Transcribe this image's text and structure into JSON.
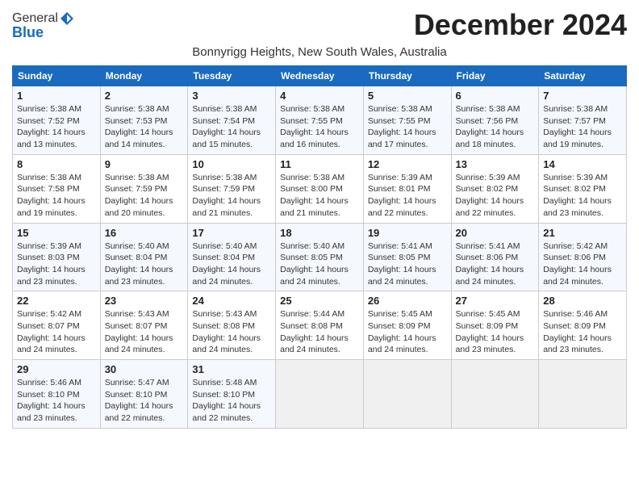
{
  "logo": {
    "general": "General",
    "blue": "Blue"
  },
  "title": "December 2024",
  "subtitle": "Bonnyrigg Heights, New South Wales, Australia",
  "days_header": [
    "Sunday",
    "Monday",
    "Tuesday",
    "Wednesday",
    "Thursday",
    "Friday",
    "Saturday"
  ],
  "weeks": [
    [
      {
        "day": "1",
        "info": "Sunrise: 5:38 AM\nSunset: 7:52 PM\nDaylight: 14 hours\nand 13 minutes."
      },
      {
        "day": "2",
        "info": "Sunrise: 5:38 AM\nSunset: 7:53 PM\nDaylight: 14 hours\nand 14 minutes."
      },
      {
        "day": "3",
        "info": "Sunrise: 5:38 AM\nSunset: 7:54 PM\nDaylight: 14 hours\nand 15 minutes."
      },
      {
        "day": "4",
        "info": "Sunrise: 5:38 AM\nSunset: 7:55 PM\nDaylight: 14 hours\nand 16 minutes."
      },
      {
        "day": "5",
        "info": "Sunrise: 5:38 AM\nSunset: 7:55 PM\nDaylight: 14 hours\nand 17 minutes."
      },
      {
        "day": "6",
        "info": "Sunrise: 5:38 AM\nSunset: 7:56 PM\nDaylight: 14 hours\nand 18 minutes."
      },
      {
        "day": "7",
        "info": "Sunrise: 5:38 AM\nSunset: 7:57 PM\nDaylight: 14 hours\nand 19 minutes."
      }
    ],
    [
      {
        "day": "8",
        "info": "Sunrise: 5:38 AM\nSunset: 7:58 PM\nDaylight: 14 hours\nand 19 minutes."
      },
      {
        "day": "9",
        "info": "Sunrise: 5:38 AM\nSunset: 7:59 PM\nDaylight: 14 hours\nand 20 minutes."
      },
      {
        "day": "10",
        "info": "Sunrise: 5:38 AM\nSunset: 7:59 PM\nDaylight: 14 hours\nand 21 minutes."
      },
      {
        "day": "11",
        "info": "Sunrise: 5:38 AM\nSunset: 8:00 PM\nDaylight: 14 hours\nand 21 minutes."
      },
      {
        "day": "12",
        "info": "Sunrise: 5:39 AM\nSunset: 8:01 PM\nDaylight: 14 hours\nand 22 minutes."
      },
      {
        "day": "13",
        "info": "Sunrise: 5:39 AM\nSunset: 8:02 PM\nDaylight: 14 hours\nand 22 minutes."
      },
      {
        "day": "14",
        "info": "Sunrise: 5:39 AM\nSunset: 8:02 PM\nDaylight: 14 hours\nand 23 minutes."
      }
    ],
    [
      {
        "day": "15",
        "info": "Sunrise: 5:39 AM\nSunset: 8:03 PM\nDaylight: 14 hours\nand 23 minutes."
      },
      {
        "day": "16",
        "info": "Sunrise: 5:40 AM\nSunset: 8:04 PM\nDaylight: 14 hours\nand 23 minutes."
      },
      {
        "day": "17",
        "info": "Sunrise: 5:40 AM\nSunset: 8:04 PM\nDaylight: 14 hours\nand 24 minutes."
      },
      {
        "day": "18",
        "info": "Sunrise: 5:40 AM\nSunset: 8:05 PM\nDaylight: 14 hours\nand 24 minutes."
      },
      {
        "day": "19",
        "info": "Sunrise: 5:41 AM\nSunset: 8:05 PM\nDaylight: 14 hours\nand 24 minutes."
      },
      {
        "day": "20",
        "info": "Sunrise: 5:41 AM\nSunset: 8:06 PM\nDaylight: 14 hours\nand 24 minutes."
      },
      {
        "day": "21",
        "info": "Sunrise: 5:42 AM\nSunset: 8:06 PM\nDaylight: 14 hours\nand 24 minutes."
      }
    ],
    [
      {
        "day": "22",
        "info": "Sunrise: 5:42 AM\nSunset: 8:07 PM\nDaylight: 14 hours\nand 24 minutes."
      },
      {
        "day": "23",
        "info": "Sunrise: 5:43 AM\nSunset: 8:07 PM\nDaylight: 14 hours\nand 24 minutes."
      },
      {
        "day": "24",
        "info": "Sunrise: 5:43 AM\nSunset: 8:08 PM\nDaylight: 14 hours\nand 24 minutes."
      },
      {
        "day": "25",
        "info": "Sunrise: 5:44 AM\nSunset: 8:08 PM\nDaylight: 14 hours\nand 24 minutes."
      },
      {
        "day": "26",
        "info": "Sunrise: 5:45 AM\nSunset: 8:09 PM\nDaylight: 14 hours\nand 24 minutes."
      },
      {
        "day": "27",
        "info": "Sunrise: 5:45 AM\nSunset: 8:09 PM\nDaylight: 14 hours\nand 23 minutes."
      },
      {
        "day": "28",
        "info": "Sunrise: 5:46 AM\nSunset: 8:09 PM\nDaylight: 14 hours\nand 23 minutes."
      }
    ],
    [
      {
        "day": "29",
        "info": "Sunrise: 5:46 AM\nSunset: 8:10 PM\nDaylight: 14 hours\nand 23 minutes."
      },
      {
        "day": "30",
        "info": "Sunrise: 5:47 AM\nSunset: 8:10 PM\nDaylight: 14 hours\nand 22 minutes."
      },
      {
        "day": "31",
        "info": "Sunrise: 5:48 AM\nSunset: 8:10 PM\nDaylight: 14 hours\nand 22 minutes."
      },
      null,
      null,
      null,
      null
    ]
  ]
}
